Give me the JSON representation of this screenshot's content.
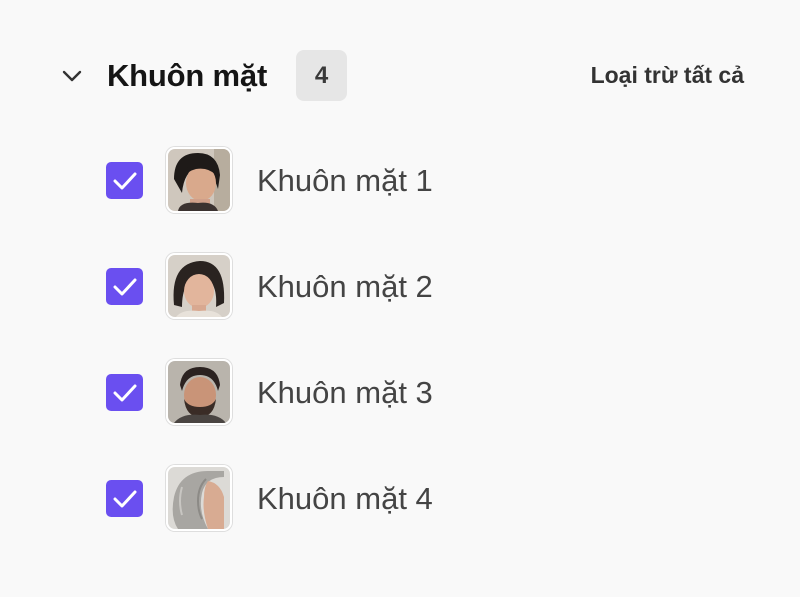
{
  "header": {
    "title": "Khuôn mặt",
    "count": "4",
    "exclude_all_label": "Loại trừ tất cả"
  },
  "faces": [
    {
      "label": "Khuôn mặt 1",
      "checked": true
    },
    {
      "label": "Khuôn mặt 2",
      "checked": true
    },
    {
      "label": "Khuôn mặt 3",
      "checked": true
    },
    {
      "label": "Khuôn mặt 4",
      "checked": true
    }
  ],
  "colors": {
    "accent": "#6a4ff0",
    "badge_bg": "#e6e6e6",
    "background": "#f9f9f9"
  },
  "icons": {
    "collapse": "chevron-down-icon",
    "check": "checkmark-icon"
  }
}
